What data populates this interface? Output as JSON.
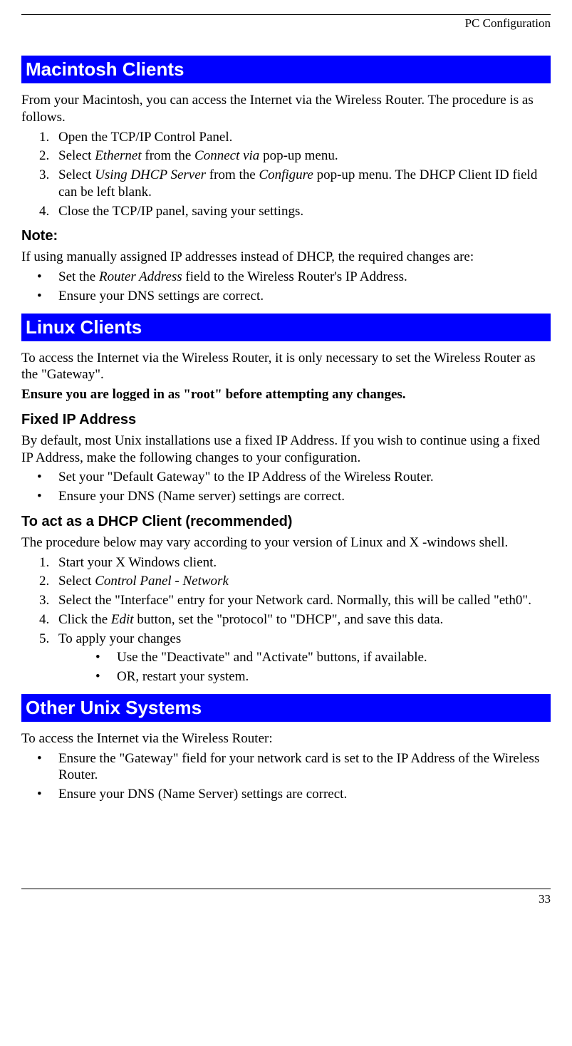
{
  "header": {
    "title": "PC Configuration"
  },
  "mac": {
    "heading": "Macintosh Clients",
    "intro": "From your Macintosh, you can access the Internet via the Wireless Router. The procedure is as follows.",
    "step1": "Open the TCP/IP Control Panel.",
    "step2_a": "Select ",
    "step2_i1": "Ethernet",
    "step2_b": " from the ",
    "step2_i2": "Connect via",
    "step2_c": " pop-up menu.",
    "step3_a": "Select ",
    "step3_i1": "Using DHCP Server",
    "step3_b": " from the ",
    "step3_i2": "Configure",
    "step3_c": " pop-up menu. The DHCP Client ID field can be left blank.",
    "step4": "Close the TCP/IP panel, saving your settings.",
    "note_heading": "Note:",
    "note_intro": "If using manually assigned IP addresses instead of DHCP, the required changes are:",
    "note_b1_a": "Set the ",
    "note_b1_i": "Router Address",
    "note_b1_b": " field to the Wireless Router's IP Address.",
    "note_b2": "Ensure your DNS settings are correct."
  },
  "linux": {
    "heading": "Linux Clients",
    "intro": "To access the Internet via the Wireless Router, it is only necessary to set the Wireless Router as the \"Gateway\".",
    "bold_line": "Ensure you are logged in as \"root\" before attempting any changes.",
    "fixed_heading": "Fixed IP Address",
    "fixed_intro": "By default, most Unix installations use a fixed IP Address. If you wish to continue using a fixed IP Address, make the following changes to your configuration.",
    "fixed_b1": "Set your \"Default Gateway\" to the IP Address of the Wireless Router.",
    "fixed_b2": "Ensure your DNS (Name server) settings are correct.",
    "dhcp_heading": "To act as a DHCP Client (recommended)",
    "dhcp_intro": "The procedure below may vary according to your version of Linux and X -windows shell.",
    "dhcp_s1": "Start your X Windows client.",
    "dhcp_s2_a": "Select ",
    "dhcp_s2_i": "Control Panel - Network",
    "dhcp_s3": "Select the \"Interface\" entry for your Network card. Normally, this will be called \"eth0\".",
    "dhcp_s4_a": "Click the ",
    "dhcp_s4_i": "Edit",
    "dhcp_s4_b": " button, set the \"protocol\" to \"DHCP\", and save this data.",
    "dhcp_s5": "To apply your changes",
    "dhcp_s5_b1": "Use the \"Deactivate\" and \"Activate\" buttons, if available.",
    "dhcp_s5_b2": "OR, restart your system."
  },
  "other": {
    "heading": "Other Unix Systems",
    "intro": "To access the Internet via the Wireless Router:",
    "b1": "Ensure the \"Gateway\" field for your network card is set to the IP Address of the Wireless Router.",
    "b2": "Ensure your DNS (Name Server) settings are correct."
  },
  "footer": {
    "page": "33"
  }
}
